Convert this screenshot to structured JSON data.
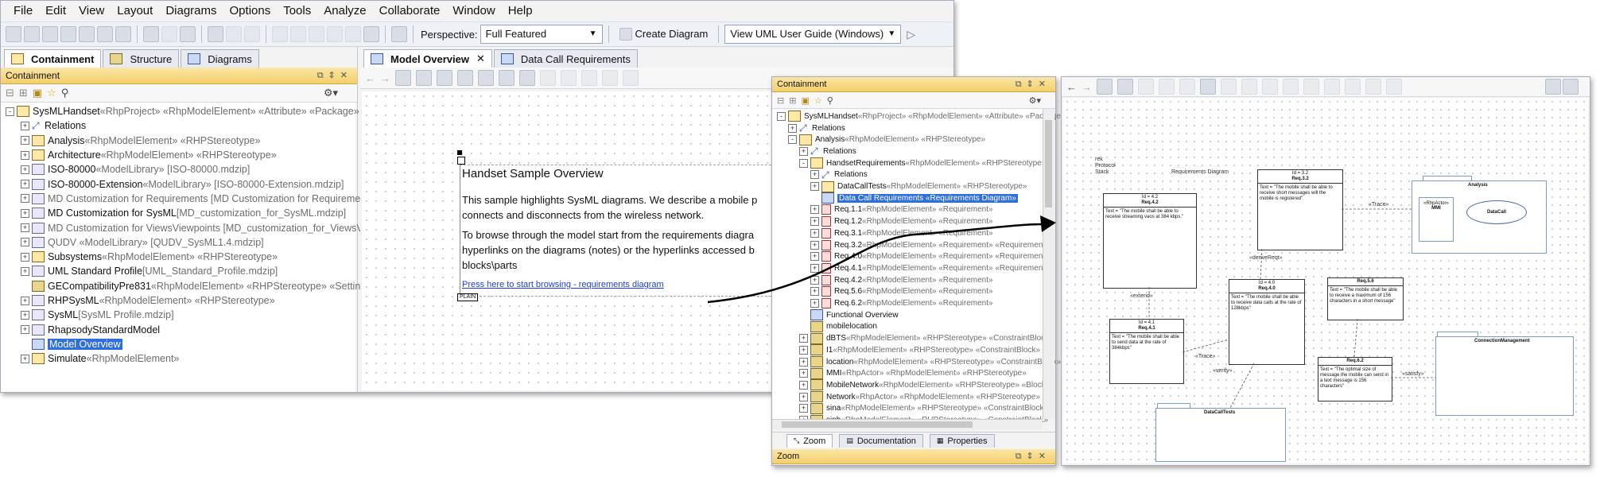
{
  "menu": [
    "File",
    "Edit",
    "View",
    "Layout",
    "Diagrams",
    "Options",
    "Tools",
    "Analyze",
    "Collaborate",
    "Window",
    "Help"
  ],
  "toolbar": {
    "perspective_label": "Perspective:",
    "perspective_value": "Full Featured",
    "create_diagram": "Create Diagram",
    "guide_value": "View UML User Guide (Windows)"
  },
  "left_tabs": [
    "Containment",
    "Structure",
    "Diagrams"
  ],
  "containment_title": "Containment",
  "left_tree": [
    {
      "text": "SysMLHandset",
      "extra": " «RhpProject» «RhpModelElement» «Attribute» «Package» «C",
      "icon": "pkg",
      "expand": "-",
      "indent": 0
    },
    {
      "text": "Relations",
      "extra": "",
      "icon": "rel",
      "expand": "+",
      "indent": 1
    },
    {
      "text": "Analysis",
      "extra": " «RhpModelElement» «RHPStereotype»",
      "icon": "pkg",
      "expand": "+",
      "indent": 1
    },
    {
      "text": "Architecture",
      "extra": " «RhpModelElement» «RHPStereotype»",
      "icon": "pkg",
      "expand": "+",
      "indent": 1
    },
    {
      "text": "ISO-80000",
      "extra": " «ModelLibrary» [ISO-80000.mdzip]",
      "icon": "lib",
      "expand": "+",
      "indent": 1
    },
    {
      "text": "ISO-80000-Extension",
      "extra": " «ModelLibrary» [ISO-80000-Extension.mdzip]",
      "icon": "lib",
      "expand": "+",
      "indent": 1
    },
    {
      "text": "MD Customization for Requirements [MD Customization for Requirement",
      "extra": "",
      "icon": "lib",
      "expand": "+",
      "indent": 1,
      "dim": true
    },
    {
      "text": "MD Customization for SysML",
      "extra": " [MD_customization_for_SysML.mdzip]",
      "icon": "lib",
      "expand": "+",
      "indent": 1
    },
    {
      "text": "MD Customization for ViewsViewpoints [MD_customization_for_ViewsVie",
      "extra": "",
      "icon": "lib",
      "expand": "+",
      "indent": 1,
      "dim": true
    },
    {
      "text": "QUDV «ModelLibrary» [QUDV_SysML1.4.mdzip]",
      "extra": "",
      "icon": "lib",
      "expand": "+",
      "indent": 1,
      "dim": true
    },
    {
      "text": "Subsystems",
      "extra": " «RhpModelElement» «RHPStereotype»",
      "icon": "pkg",
      "expand": "+",
      "indent": 1
    },
    {
      "text": "UML Standard Profile",
      "extra": " [UML_Standard_Profile.mdzip]",
      "icon": "lib",
      "expand": "+",
      "indent": 1
    },
    {
      "text": "GECompatibilityPre831",
      "extra": " «RhpModelElement» «RHPStereotype» «Settings»",
      "icon": "blk",
      "expand": "",
      "indent": 1
    },
    {
      "text": "RHPSysML",
      "extra": " «RhpModelElement» «RHPStereotype»",
      "icon": "lib",
      "expand": "+",
      "indent": 1
    },
    {
      "text": "SysML",
      "extra": " [SysML Profile.mdzip]",
      "icon": "lib",
      "expand": "+",
      "indent": 1
    },
    {
      "text": "RhapsodyStandardModel",
      "extra": "",
      "icon": "lib",
      "expand": "+",
      "indent": 1
    },
    {
      "text": "Model Overview",
      "extra": "",
      "icon": "diag",
      "expand": "",
      "indent": 1,
      "selected": true
    },
    {
      "text": "Simulate",
      "extra": " «RhpModelElement»",
      "icon": "pkg",
      "expand": "+",
      "indent": 1
    }
  ],
  "editor_tabs": [
    "Model Overview",
    "Data Call Requirements"
  ],
  "overview_note": {
    "title": "Handset Sample Overview",
    "para1": "This sample highlights SysML diagrams. We describe a mobile p connects and disconnects from the wireless network.",
    "para2": "To browse through the model start from the requirements diagra hyperlinks on the diagrams (notes) or the hyperlinks accessed b blocks\\parts",
    "link": "Press here to start browsing - requirements diagram",
    "plain_tag": "PLAIN"
  },
  "popup_containment_title": "Containment",
  "popup_tree": [
    {
      "text": "SysMLHandset",
      "extra": " «RhpProject» «RhpModelElement» «Attribute» «Package» «C",
      "icon": "pkg",
      "expand": "-",
      "indent": 0
    },
    {
      "text": "Relations",
      "extra": "",
      "icon": "rel",
      "expand": "+",
      "indent": 1
    },
    {
      "text": "Analysis",
      "extra": " «RhpModelElement» «RHPStereotype»",
      "icon": "pkg",
      "expand": "-",
      "indent": 1
    },
    {
      "text": "Relations",
      "extra": "",
      "icon": "rel",
      "expand": "+",
      "indent": 2
    },
    {
      "text": "HandsetRequirements",
      "extra": " «RhpModelElement» «RHPStereotype»",
      "icon": "pkg",
      "expand": "-",
      "indent": 2
    },
    {
      "text": "Relations",
      "extra": "",
      "icon": "rel",
      "expand": "+",
      "indent": 3
    },
    {
      "text": "DataCallTests",
      "extra": " «RhpModelElement» «RHPStereotype»",
      "icon": "pkg",
      "expand": "+",
      "indent": 3
    },
    {
      "text": "Data Call Requirements «Requirements Diagram»",
      "extra": "",
      "icon": "diag",
      "expand": "",
      "indent": 3,
      "selected": true
    },
    {
      "text": "Req.1.1",
      "extra": " «RhpModelElement» «Requirement»",
      "icon": "req",
      "expand": "+",
      "indent": 3
    },
    {
      "text": "Req.1.2",
      "extra": " «RhpModelElement» «Requirement»",
      "icon": "req",
      "expand": "+",
      "indent": 3
    },
    {
      "text": "Req.3.1",
      "extra": " «RhpModelElement» «Requirement»",
      "icon": "req",
      "expand": "+",
      "indent": 3
    },
    {
      "text": "Req.3.2",
      "extra": " «RhpModelElement» «Requirement» «Requirement",
      "icon": "req",
      "expand": "+",
      "indent": 3
    },
    {
      "text": "Req.4.0",
      "extra": " «RhpModelElement» «Requirement» «RequirementF",
      "icon": "req",
      "expand": "+",
      "indent": 3
    },
    {
      "text": "Req.4.1",
      "extra": " «RhpModelElement» «Requirement» «Requirement",
      "icon": "req",
      "expand": "+",
      "indent": 3
    },
    {
      "text": "Req.4.2",
      "extra": " «RhpModelElement» «Requirement»",
      "icon": "req",
      "expand": "+",
      "indent": 3
    },
    {
      "text": "Req.5.6",
      "extra": " «RhpModelElement» «Requirement»",
      "icon": "req",
      "expand": "+",
      "indent": 3
    },
    {
      "text": "Req.6.2",
      "extra": " «RhpModelElement» «Requirement»",
      "icon": "req",
      "expand": "+",
      "indent": 3
    },
    {
      "text": "Functional Overview",
      "extra": "",
      "icon": "diag",
      "expand": "",
      "indent": 2
    },
    {
      "text": "mobilelocation",
      "extra": "",
      "icon": "blk",
      "expand": "",
      "indent": 2
    },
    {
      "text": "dBTS",
      "extra": " «RhpModelElement» «RHPStereotype» «ConstraintBlock»",
      "icon": "blk",
      "expand": "+",
      "indent": 2
    },
    {
      "text": "I1",
      "extra": " «RhpModelElement» «RHPStereotype» «ConstraintBlock»",
      "icon": "blk",
      "expand": "+",
      "indent": 2
    },
    {
      "text": "location",
      "extra": " «RhpModelElement» «RHPStereotype» «ConstraintBlock»",
      "icon": "blk",
      "expand": "+",
      "indent": 2
    },
    {
      "text": "MMI",
      "extra": " «RhpActor» «RhpModelElement» «RHPStereotype»",
      "icon": "blk",
      "expand": "+",
      "indent": 2
    },
    {
      "text": "MobileNetwork",
      "extra": " «RhpModelElement» «RHPStereotype» «Block»",
      "icon": "blk",
      "expand": "+",
      "indent": 2
    },
    {
      "text": "Network",
      "extra": " «RhpActor» «RhpModelElement» «RHPStereotype»",
      "icon": "blk",
      "expand": "+",
      "indent": 2
    },
    {
      "text": "sina",
      "extra": " «RhpModelElement» «RHPStereotype» «ConstraintBlock»",
      "icon": "blk",
      "expand": "+",
      "indent": 2
    },
    {
      "text": "sinh",
      "extra": " «RhpModelElement» «RHPStereotype» «ConstraintBlock»",
      "icon": "blk",
      "expand": "+",
      "indent": 2
    }
  ],
  "popup_bottom_tabs": [
    "Zoom",
    "Documentation",
    "Properties"
  ],
  "popup_zoom_title": "Zoom",
  "diagram": {
    "header_left": "rek\nProtocol\nStack",
    "header_title": "Requirements Diagram",
    "blocks": [
      {
        "id": "Id = 4.2",
        "name": "Req.4.2",
        "text": "Text = \"The mobile shall be able to receive streaming vaos at 384 kbps.\""
      },
      {
        "id": "Id = 3.2",
        "name": "Req.3.2",
        "text": "Text = \"The mobile shall be able to receive short messages will the mobile is registered\""
      },
      {
        "id": "Id = 4.1",
        "name": "Req.4.1",
        "text": "Text = \"The mobile shall be able to send data at the rate of 384kbps\""
      },
      {
        "id": "Id = 4.0",
        "name": "Req.4.0",
        "text": "Text = \"The mobile shall be able to receive data calls at the rate of 128kbps\""
      },
      {
        "id": "",
        "name": "Req.5.6",
        "text": "Text = \"The mobile shall be able to receive a maximum of 156 characters in a short message\""
      },
      {
        "id": "",
        "name": "Req.6.2",
        "text": "Text = \"The optimal size of message the mobile can send in a text message is 156 characters\""
      }
    ],
    "labels": {
      "trace1": "«Trace»",
      "trace2": "«Trace»",
      "derive": "«deriveReqt»",
      "extend": "«extend»",
      "verify": "«verify»",
      "satisfy": "«satisfy»"
    },
    "packages": {
      "analysis": "Analysis",
      "datacalltests": "DataCallTests",
      "connection": "ConnectionManagement"
    },
    "actor_stereo": "«RhpActor»",
    "actor_name": "MMI",
    "usecase": "DataCall"
  }
}
